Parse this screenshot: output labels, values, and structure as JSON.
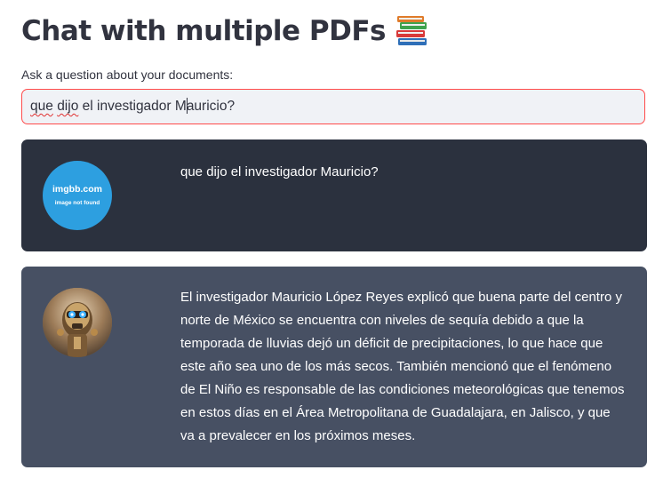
{
  "header": {
    "title": "Chat with multiple PDFs",
    "title_icon": "books-icon"
  },
  "question": {
    "label": "Ask a question about your documents:",
    "value_part1": "que dijo el investigador M",
    "value_part2": "auricio?",
    "spell_error_words": [
      "que",
      "dijo"
    ]
  },
  "chat": {
    "user_message": {
      "avatar_site": "imgbb.com",
      "avatar_error": "image not found",
      "text": "que dijo el investigador Mauricio?"
    },
    "bot_message": {
      "avatar_icon": "robot-avatar-icon",
      "text": "El investigador Mauricio López Reyes explicó que buena parte del centro y norte de México se encuentra con niveles de sequía debido a que la temporada de lluvias dejó un déficit de precipitaciones, lo que hace que este año sea uno de los más secos. También mencionó que el fenómeno de El Niño es responsable de las condiciones meteorológicas que tenemos en estos días en el Área Metropolitana de Guadalajara, en Jalisco, y que va a prevalecer en los próximos meses."
    }
  },
  "colors": {
    "accent_border": "#ff4b4b",
    "user_bg": "#2b313e",
    "bot_bg": "#475063",
    "avatar_blue": "#2d9fe0"
  }
}
